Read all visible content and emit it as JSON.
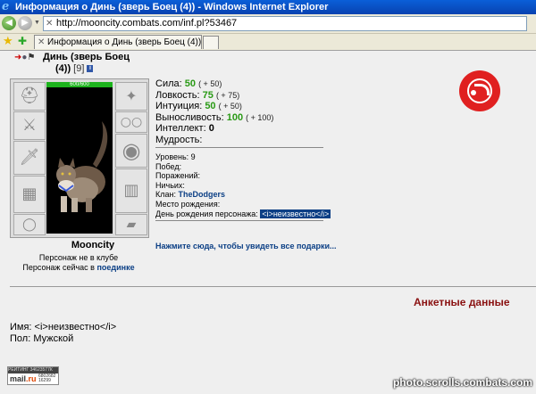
{
  "window": {
    "title": "Информация о Динь (зверь Боец (4)) - Windows Internet Explorer"
  },
  "address_bar": {
    "url": "http://mooncity.combats.com/inf.pl?53467"
  },
  "tab": {
    "label": "Информация о Динь (зверь Боец (4))"
  },
  "character": {
    "name_line1": "Динь (зверь Боец",
    "name_line2": "(4))",
    "level_bracket": "[9]",
    "info_icon": "i",
    "hp": "600/600",
    "city": "Mooncity",
    "status_club": "Персонаж не в клубе",
    "status_now_prefix": "Персонаж сейчас в",
    "status_now_link": "поединке"
  },
  "stats": [
    {
      "label": "Сила:",
      "value": "50",
      "bonus": "( + 50)"
    },
    {
      "label": "Ловкость:",
      "value": "75",
      "bonus": "( + 75)"
    },
    {
      "label": "Интуиция:",
      "value": "50",
      "bonus": "( + 50)"
    },
    {
      "label": "Выносливость:",
      "value": "100",
      "bonus": "( + 100)"
    },
    {
      "label": "Интеллект:",
      "value": "0",
      "bonus": ""
    },
    {
      "label": "Мудрость:",
      "value": "",
      "bonus": ""
    }
  ],
  "info": {
    "level": "Уровень: 9",
    "wins": "Побед:",
    "losses": "Поражений:",
    "draws": "Ничьих:",
    "clan_label": "Клан:",
    "clan_name": "TheDodgers",
    "birthplace": "Место рождения:",
    "birthday_label": "День рождения персонажа:",
    "birthday_value": "<i>неизвестно</i>"
  },
  "gifts_link": "Нажмите сюда, чтобы увидеть все подарки...",
  "anket": {
    "title": "Анкетные данные",
    "name_row": "Имя: <i>неизвестно</i>",
    "sex_row": "Пол: Мужской"
  },
  "counter": {
    "top": "РЕЙТИНГ 34623577К",
    "logo_a": "mail",
    "logo_b": ".ru",
    "num1": "6802682",
    "num2": "16299"
  },
  "watermark": "photo.scrolls.combats.com",
  "colors": {
    "titlebar": "#0842b0",
    "stat_value": "#2a9a16",
    "link": "#0b3f85",
    "anket": "#8a1111",
    "emblem": "#e02020"
  }
}
